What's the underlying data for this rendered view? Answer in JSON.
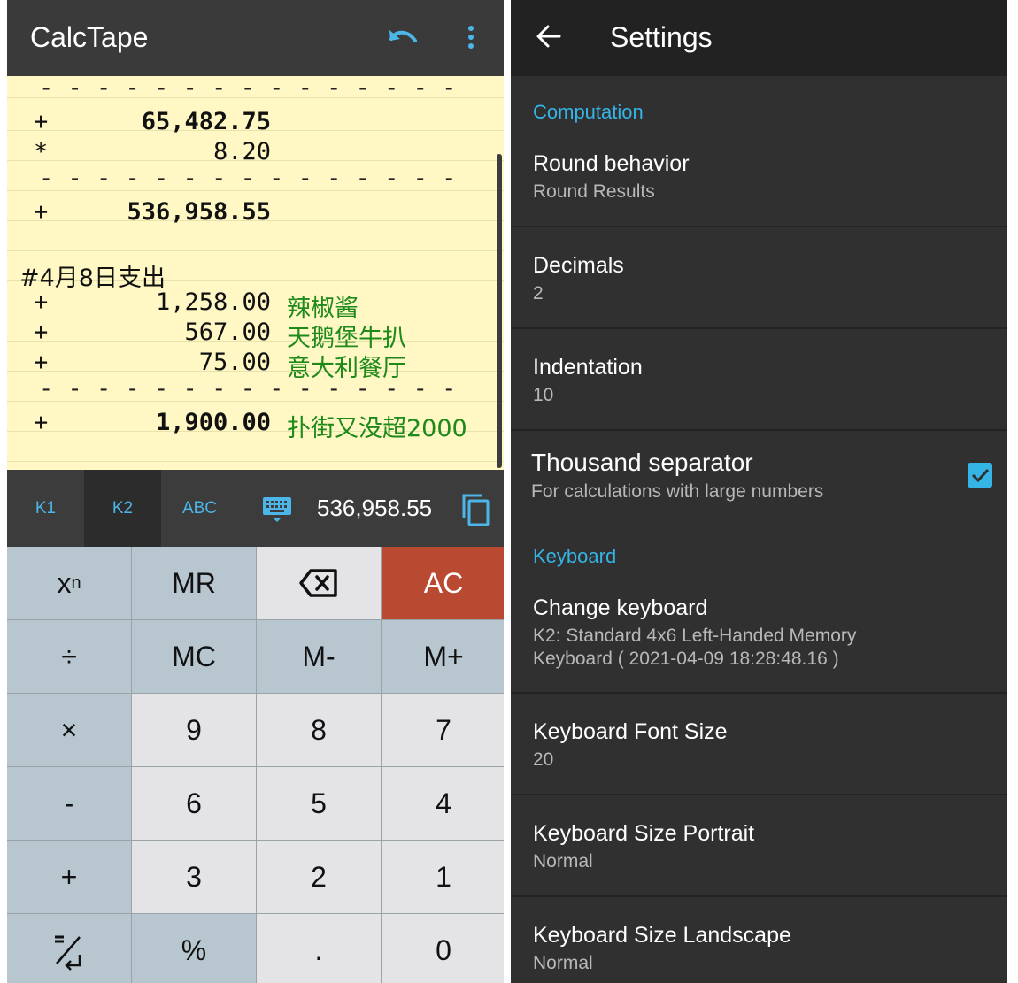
{
  "left": {
    "app_title": "CalcTape",
    "icons": {
      "undo": "undo-icon",
      "menu": "more-vert-icon",
      "keyboard": "keyboard-icon",
      "copy": "copy-icon"
    },
    "tape": {
      "dash": "- - - - - - - - - - - - - - -",
      "line1": {
        "op": "+",
        "num": "65,482.75"
      },
      "line2": {
        "op": "*",
        "num": "8.20"
      },
      "line3": {
        "op": "+",
        "num": "536,958.55"
      },
      "header": "#4月8日支出",
      "line4": {
        "op": "+",
        "num": "1,258.00",
        "note": "辣椒酱"
      },
      "line5": {
        "op": "+",
        "num": "567.00",
        "note": "天鹅堡牛扒"
      },
      "line6": {
        "op": "+",
        "num": "75.00",
        "note": "意大利餐厅"
      },
      "line7": {
        "op": "+",
        "num": "1,900.00",
        "note": "扑街又没超2000"
      }
    },
    "kb_tabs": [
      "K1",
      "K2",
      "ABC"
    ],
    "kb_active": "K2",
    "display_value": "536,958.55",
    "keys": {
      "r0": [
        "x",
        "MR",
        "",
        "AC"
      ],
      "power_sup": "n",
      "r1": [
        "÷",
        "MC",
        "M-",
        "M+"
      ],
      "r2": [
        "×",
        "9",
        "8",
        "7"
      ],
      "r3": [
        "-",
        "6",
        "5",
        "4"
      ],
      "r4": [
        "+",
        "3",
        "2",
        "1"
      ],
      "r5": [
        "",
        "%",
        ".",
        "0"
      ]
    },
    "colors": {
      "tape_bg": "#fff8c4",
      "note_green": "#1d8a1a",
      "accent_blue": "#4db6e8",
      "ac_red": "#b94a31"
    }
  },
  "right": {
    "title": "Settings",
    "cat_computation": "Computation",
    "round_title": "Round behavior",
    "round_sub": "Round Results",
    "decimals_title": "Decimals",
    "decimals_sub": "2",
    "indent_title": "Indentation",
    "indent_sub": "10",
    "thousand_title": "Thousand separator",
    "thousand_sub": "For calculations with large numbers",
    "thousand_checked": true,
    "cat_keyboard": "Keyboard",
    "change_kb_title": "Change keyboard",
    "change_kb_sub1": "K2: Standard 4x6 Left-Handed Memory",
    "change_kb_sub2": "Keyboard ( 2021-04-09 18:28:48.16 )",
    "font_title": "Keyboard Font Size",
    "font_sub": "20",
    "portrait_title": "Keyboard Size Portrait",
    "portrait_sub": "Normal",
    "landscape_title": "Keyboard Size Landscape",
    "landscape_sub": "Normal",
    "colors": {
      "accent": "#35b4e6",
      "bg": "#303030"
    }
  }
}
